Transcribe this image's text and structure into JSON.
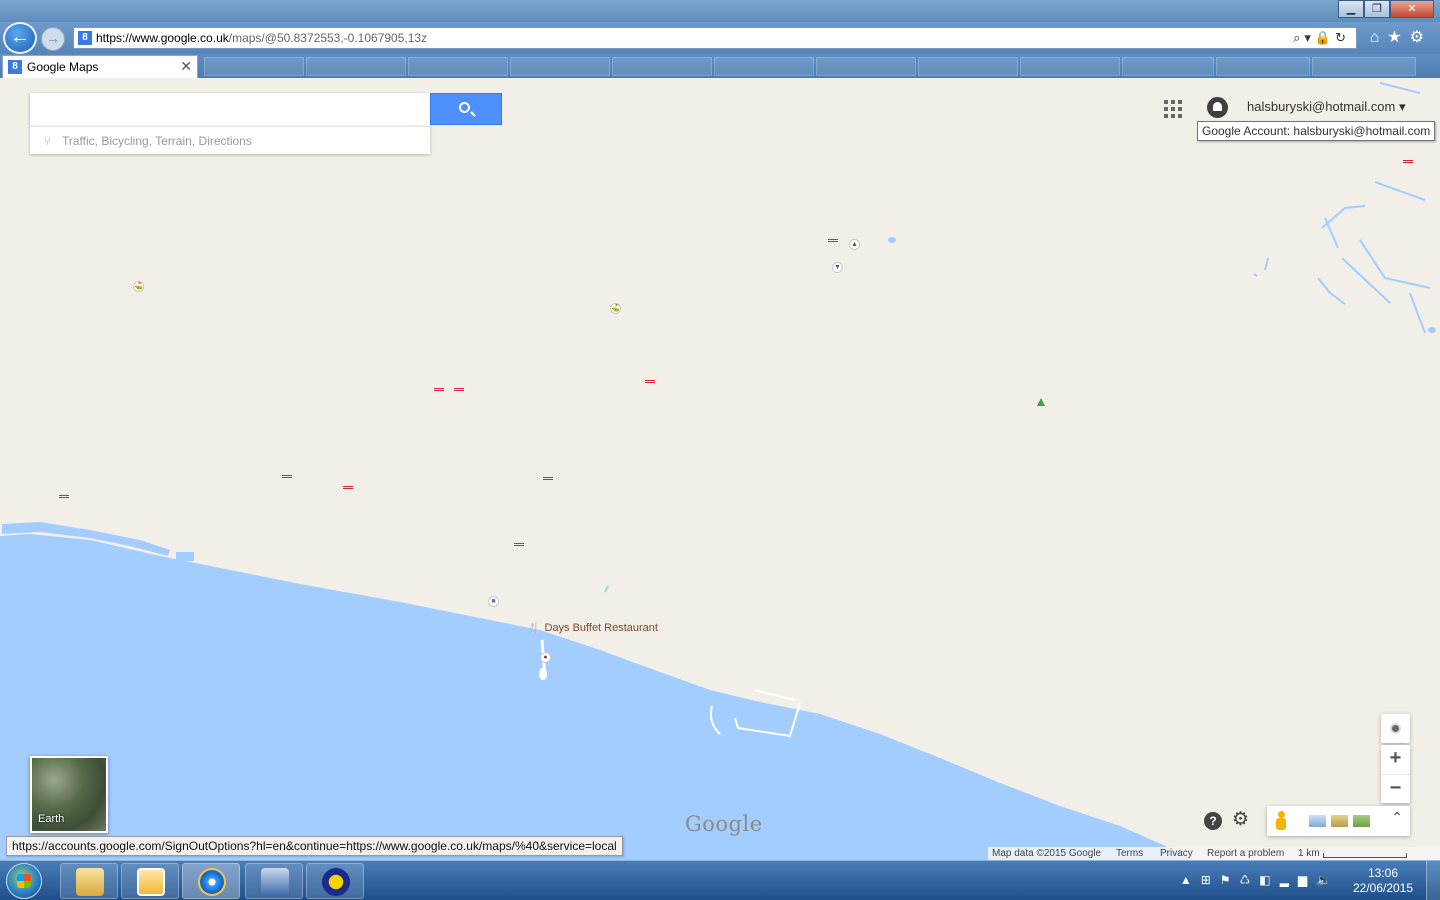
{
  "window": {
    "minimize": "▁",
    "maximize": "❐",
    "close": "✕"
  },
  "browser": {
    "url_host": "https://www.google.co.uk",
    "url_path": "/maps/@50.8372553,-0.1067905,13z",
    "address_icons": "⌕▾🔒↻",
    "tool_icons": "⌂★⚙",
    "tab": {
      "favicon": "8",
      "title": "Google Maps",
      "close": "✕"
    },
    "status_url": "https://accounts.google.com/SignOutOptions?hl=en&continue=https://www.google.co.uk/maps/%40&service=local"
  },
  "map": {
    "search_placeholder": "",
    "suggestions": "Traffic, Bicycling, Terrain, Directions",
    "account_email": "halsburyski@hotmail.com",
    "account_caret": "▾",
    "account_tooltip": "Google Account: halsburyski@hotmail.com",
    "restaurant_label": "Days Buffet Restaurant",
    "earth_label": "Earth",
    "logo": "Google",
    "zoom_in": "+",
    "zoom_out": "−",
    "help": "?",
    "settings": "⚙",
    "layers_chevron": "⌃",
    "footer": {
      "map_data": "Map data ©2015 Google",
      "terms": "Terms",
      "privacy": "Privacy",
      "report": "Report a problem",
      "scale": "1 km"
    },
    "colors": {
      "land": "#f2efe9",
      "water": "#a3ccff",
      "rail": "#d7272f",
      "search_button": "#4d90fe"
    }
  },
  "taskbar": {
    "tray_icons": "▲⊞⚑♺◧▂▆🔈",
    "time": "13:06",
    "date": "22/06/2015"
  }
}
